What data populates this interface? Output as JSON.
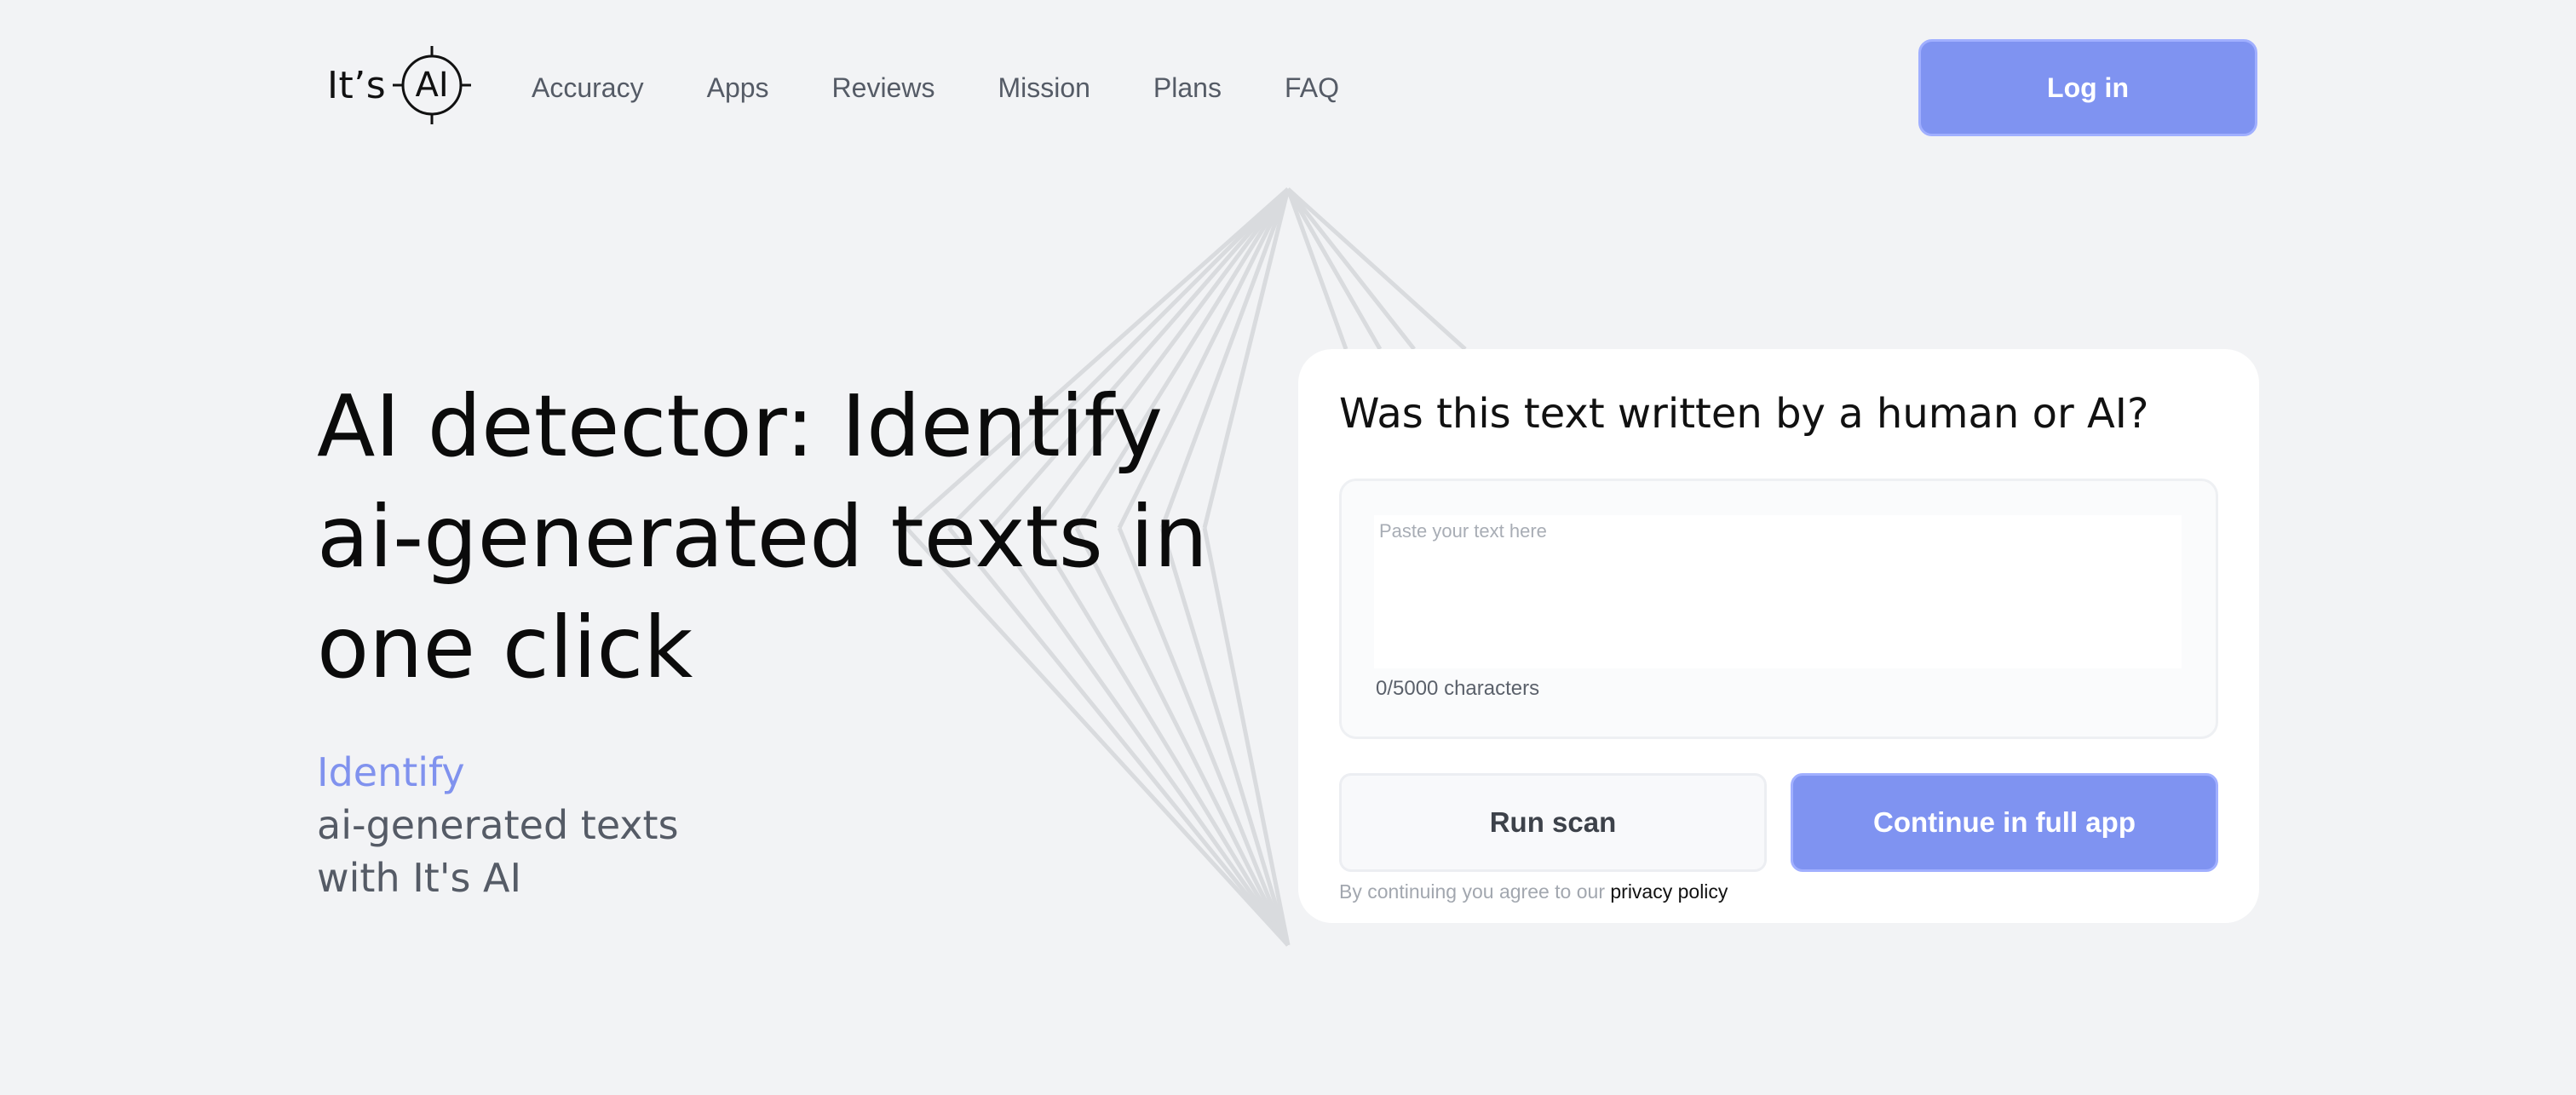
{
  "header": {
    "logo_text": "It’s",
    "logo_mark": "AI",
    "nav": [
      "Accuracy",
      "Apps",
      "Reviews",
      "Mission",
      "Plans",
      "FAQ"
    ],
    "login_label": "Log in"
  },
  "hero": {
    "title": "AI detector: Identify ai-generated texts in one click",
    "subtitle_accent": "Identify",
    "subtitle_line1": "ai-generated texts",
    "subtitle_line2": "with It's AI"
  },
  "card": {
    "title": "Was this text written by a human or AI?",
    "textarea_placeholder": "Paste your text here",
    "textarea_value": "",
    "char_count": "0/5000 characters",
    "run_label": "Run scan",
    "continue_label": "Continue in full app",
    "consent_prefix": "By continuing you agree to our",
    "consent_link": "privacy policy"
  },
  "colors": {
    "accent": "#7f93f1",
    "background": "#f2f3f5",
    "card": "#ffffff"
  },
  "icons": {
    "logo": "crosshair-icon"
  }
}
